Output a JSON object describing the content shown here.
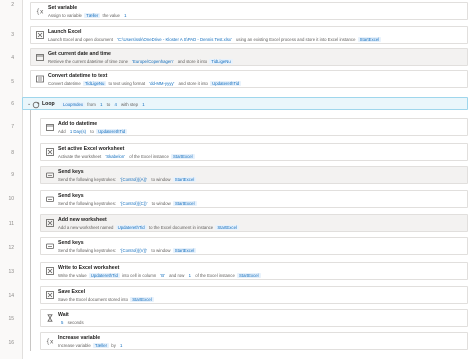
{
  "steps": [
    {
      "num": "2",
      "title": "Set variable",
      "desc_parts": [
        {
          "t": "Assign to variable "
        },
        {
          "v": "Tæller"
        },
        {
          "t": " the value "
        },
        {
          "s": "1"
        }
      ]
    },
    {
      "num": "3",
      "title": "Launch Excel",
      "desc_parts": [
        {
          "t": "Launch Excel and open document "
        },
        {
          "s": "'C:\\Users\\ssk\\OneDrive - Kloster A S\\PAD - Dennis Test.xlsx'"
        },
        {
          "t": " using an existing Excel process and store it into Excel instance "
        },
        {
          "v": "StartExcel"
        }
      ]
    },
    {
      "num": "4",
      "title": "Get current date and time",
      "desc_parts": [
        {
          "t": "Retrieve the current datetime of time zone "
        },
        {
          "s": "'Europe/Copenhagen'"
        },
        {
          "t": " and store it into "
        },
        {
          "v": "TidLigeNu"
        }
      ]
    },
    {
      "num": "5",
      "title": "Convert datetime to text",
      "desc_parts": [
        {
          "t": "Convert datetime "
        },
        {
          "v": "TidLigeNu"
        },
        {
          "t": " to text using format "
        },
        {
          "s": "'dd-MM-yyyy'"
        },
        {
          "t": " and store it into "
        },
        {
          "v": "UpdaterethTid"
        }
      ]
    },
    {
      "num": "6",
      "title": "Loop",
      "desc_parts": [
        {
          "v": "LoopIndex"
        },
        {
          "t": " from "
        },
        {
          "s": "1"
        },
        {
          "t": " to "
        },
        {
          "s": "4"
        },
        {
          "t": " with step "
        },
        {
          "s": "1"
        }
      ]
    },
    {
      "num": "7",
      "title": "Add to datetime",
      "desc_parts": [
        {
          "t": "Add "
        },
        {
          "s": "1 Day(s)"
        },
        {
          "t": " to "
        },
        {
          "v": "UpdaterethTid"
        }
      ]
    },
    {
      "num": "8",
      "title": "Set active Excel worksheet",
      "desc_parts": [
        {
          "t": "Activate the worksheet "
        },
        {
          "s": "'Skabelon'"
        },
        {
          "t": " of the Excel instance "
        },
        {
          "v": "StartExcel"
        }
      ]
    },
    {
      "num": "9",
      "title": "Send keys",
      "desc_parts": [
        {
          "t": "Send the following keystrokes: "
        },
        {
          "s": "'{Control}({A})'"
        },
        {
          "t": " to window "
        },
        {
          "v": "StartExcel"
        }
      ]
    },
    {
      "num": "10",
      "title": "Send keys",
      "desc_parts": [
        {
          "t": "Send the following keystrokes: "
        },
        {
          "s": "'{Control}({C})'"
        },
        {
          "t": " to window "
        },
        {
          "v": "StartExcel"
        }
      ]
    },
    {
      "num": "11",
      "title": "Add new worksheet",
      "desc_parts": [
        {
          "t": "Add a new worksheet named "
        },
        {
          "v": "UpdaterethTid"
        },
        {
          "t": " to the Excel document in instance "
        },
        {
          "v": "StartExcel"
        }
      ]
    },
    {
      "num": "12",
      "title": "Send keys",
      "desc_parts": [
        {
          "t": "Send the following keystrokes: "
        },
        {
          "s": "'{Control}({V})'"
        },
        {
          "t": " to window "
        },
        {
          "v": "StartExcel"
        }
      ]
    },
    {
      "num": "13",
      "title": "Write to Excel worksheet",
      "desc_parts": [
        {
          "t": "Write the value "
        },
        {
          "v": "UpdaterethTid"
        },
        {
          "t": " into cell in column "
        },
        {
          "s": "'B'"
        },
        {
          "t": " and row "
        },
        {
          "s": "1"
        },
        {
          "t": " of the Excel instance "
        },
        {
          "v": "StartExcel"
        }
      ]
    },
    {
      "num": "14",
      "title": "Save Excel",
      "desc_parts": [
        {
          "t": "Save the Excel document stored into "
        },
        {
          "v": "StartExcel"
        }
      ]
    },
    {
      "num": "15",
      "title": "Wait",
      "desc_parts": [
        {
          "s": "5"
        },
        {
          "t": " seconds"
        }
      ]
    },
    {
      "num": "16",
      "title": "Increase variable",
      "desc_parts": [
        {
          "t": "Increase variable "
        },
        {
          "v": "Tæller"
        },
        {
          "t": " by "
        },
        {
          "s": "1"
        }
      ]
    }
  ],
  "colors": {
    "accent": "#0f6cbd",
    "loop_bg": "#eaf6fb"
  },
  "icons": [
    "variable-icon",
    "excel-icon",
    "calendar-icon",
    "text-icon",
    "loop-icon",
    "calendar-icon",
    "excel-icon",
    "keyboard-icon",
    "keyboard-icon",
    "excel-icon",
    "keyboard-icon",
    "excel-icon",
    "excel-icon",
    "hourglass-icon",
    "variable-icon"
  ]
}
